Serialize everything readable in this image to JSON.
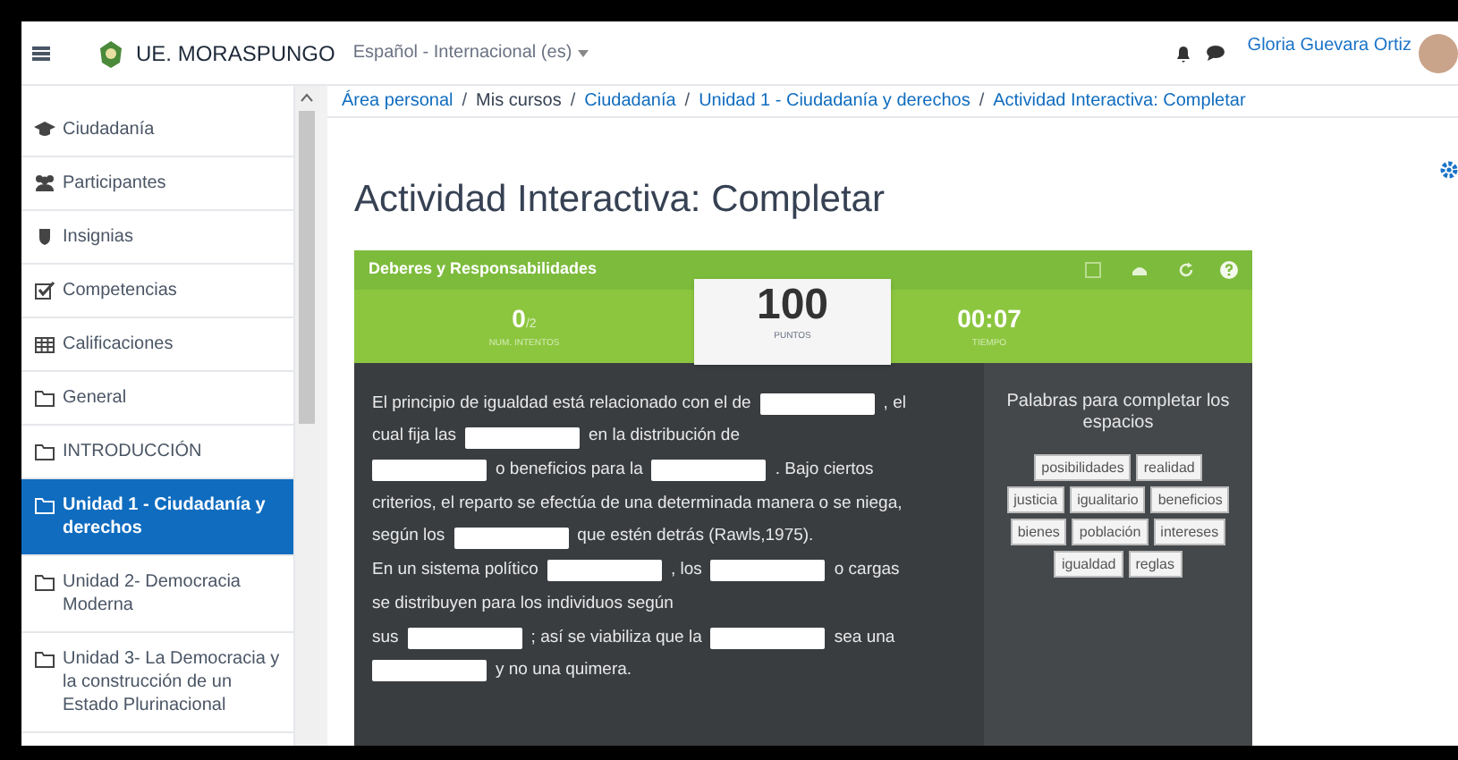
{
  "navbar": {
    "site_name": "UE. MORASPUNGO",
    "language": "Español - Internacional (es)",
    "user_name": "Gloria Guevara Ortiz"
  },
  "sidebar": {
    "items": [
      {
        "label": "Ciudadanía",
        "selected": false
      },
      {
        "label": "Participantes",
        "selected": false
      },
      {
        "label": "Insignias",
        "selected": false
      },
      {
        "label": "Competencias",
        "selected": false
      },
      {
        "label": "Calificaciones",
        "selected": false
      },
      {
        "label": "General",
        "selected": false
      },
      {
        "label": "INTRODUCCIÓN",
        "selected": false
      },
      {
        "label": "Unidad 1 - Ciudadanía y derechos",
        "selected": true
      },
      {
        "label": "Unidad 2- Democracia Moderna",
        "selected": false
      },
      {
        "label": "Unidad 3- La Democracia y la construcción de un Estado Plurinacional",
        "selected": false
      }
    ]
  },
  "breadcrumb": [
    {
      "label": "Área personal",
      "link": true
    },
    {
      "separator": "/",
      "label": "Mis cursos",
      "link": false
    },
    {
      "separator": "/",
      "label": "Ciudadanía",
      "link": true
    },
    {
      "separator": "/",
      "label": "Unidad 1 - Ciudadanía y derechos",
      "link": true
    },
    {
      "separator": "/",
      "label": "Actividad Interactiva: Completar",
      "link": true
    }
  ],
  "page_title": "Actividad Interactiva: Completar",
  "activity": {
    "title": "Deberes y Responsabilidades",
    "attempts": {
      "value": "0",
      "max": "/2",
      "label": "NUM. INTENTOS"
    },
    "points": {
      "value": "100",
      "label": "PUNTOS"
    },
    "time": {
      "value": "00:07",
      "label": "TIEMPO"
    },
    "lines": [
      [
        {
          "kind": "text",
          "text": "El principio de igualdad está relacionado con el de"
        },
        {
          "kind": "blank"
        },
        {
          "kind": "text",
          "text": ", el"
        }
      ],
      [
        {
          "kind": "text",
          "text": "cual fija las"
        },
        {
          "kind": "blank"
        },
        {
          "kind": "text",
          "text": "en la distribución de"
        }
      ],
      [
        {
          "kind": "blank"
        },
        {
          "kind": "text",
          "text": "o beneficios para la"
        },
        {
          "kind": "blank"
        },
        {
          "kind": "text",
          "text": ". Bajo ciertos"
        }
      ],
      [
        {
          "kind": "text",
          "text": "criterios, el reparto se efectúa de una determinada manera o se niega,"
        }
      ],
      [
        {
          "kind": "text",
          "text": "según los"
        },
        {
          "kind": "blank"
        },
        {
          "kind": "text",
          "text": "que estén detrás (Rawls,1975)."
        }
      ],
      [
        {
          "kind": "text",
          "text": "En un sistema político"
        },
        {
          "kind": "blank"
        },
        {
          "kind": "text",
          "text": ", los"
        },
        {
          "kind": "blank"
        },
        {
          "kind": "text",
          "text": "o cargas"
        }
      ],
      [
        {
          "kind": "text",
          "text": "se distribuyen para los individuos según"
        }
      ],
      [
        {
          "kind": "text",
          "text": "sus"
        },
        {
          "kind": "blank"
        },
        {
          "kind": "text",
          "text": "; así se viabiliza que la"
        },
        {
          "kind": "blank"
        },
        {
          "kind": "text",
          "text": "sea una"
        }
      ],
      [
        {
          "kind": "blank"
        },
        {
          "kind": "text",
          "text": "y no una quimera."
        }
      ]
    ],
    "words_title": "Palabras para completar los espacios",
    "word_rows": [
      [
        "posibilidades",
        "realidad"
      ],
      [
        "justicia",
        "igualitario",
        "beneficios"
      ],
      [
        "bienes",
        "población",
        "intereses"
      ],
      [
        "igualdad",
        "reglas"
      ]
    ]
  }
}
